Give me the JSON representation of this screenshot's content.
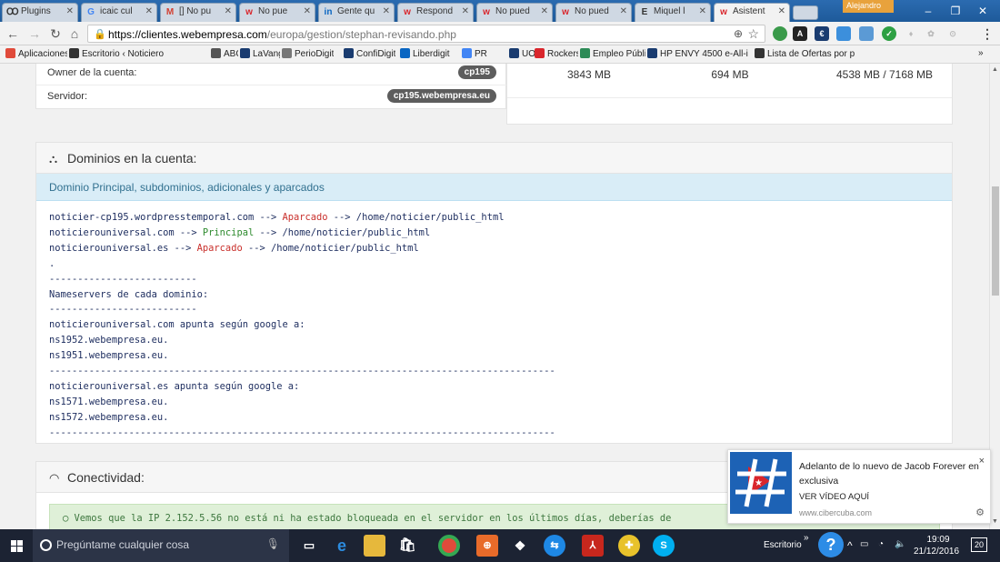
{
  "browser": {
    "tabs": [
      {
        "label": "Plugins",
        "icon": "wp-icon"
      },
      {
        "label": "icaic cul",
        "icon": "google-icon"
      },
      {
        "label": "[] No pu",
        "icon": "gmail-icon"
      },
      {
        "label": "No pue",
        "icon": "w-icon"
      },
      {
        "label": "Gente qu",
        "icon": "linkedin-icon"
      },
      {
        "label": "Respond",
        "icon": "w-icon"
      },
      {
        "label": "No pued",
        "icon": "w-icon"
      },
      {
        "label": "No pued",
        "icon": "w-icon"
      },
      {
        "label": "Miquel l",
        "icon": "e-icon"
      },
      {
        "label": "Asistent",
        "icon": "w-icon"
      }
    ],
    "profile_label": "Alejandro",
    "url": {
      "scheme": "https://",
      "host": "clientes.webempresa.com",
      "path": "/europa/gestion/stephan-revisando.php"
    },
    "bookmarks": [
      "Aplicaciones",
      "Escritorio ‹ Noticiero",
      "ABC",
      "LaVang",
      "PerioDigit",
      "ConfiDigit",
      "Liberdigit",
      "PR",
      "UOC",
      "Rockers",
      "Empleo Público orden",
      "HP ENVY 4500 e-All-i",
      "Lista de Ofertas por p"
    ],
    "bookmarks_overflow": "»"
  },
  "account": {
    "owner_label": "Owner de la cuenta:",
    "owner_value": "cp195",
    "server_label": "Servidor:",
    "server_value": "cp195.webempresa.eu"
  },
  "disk": {
    "stat1": "3843 MB",
    "stat2": "694 MB",
    "stat3": "4538 MB / 7168 MB"
  },
  "domains": {
    "title": "Dominios en la cuenta:",
    "subtitle": "Dominio Principal, subdominios, adicionales y aparcados",
    "lines": [
      {
        "pre": "noticier-cp195.wordpresstemporal.com --> ",
        "tag": "Aparcado",
        "tag_color": "red",
        "post": " --> /home/noticier/public_html"
      },
      {
        "pre": "noticierouniversal.com --> ",
        "tag": "Principal",
        "tag_color": "green",
        "post": " --> /home/noticier/public_html"
      },
      {
        "pre": "noticierouniversal.es --> ",
        "tag": "Aparcado",
        "tag_color": "red",
        "post": " --> /home/noticier/public_html"
      }
    ],
    "plain_lines": [
      ".",
      "--------------------------",
      "Nameservers de cada dominio:",
      "--------------------------",
      "noticierouniversal.com apunta según google a:",
      "ns1952.webempresa.eu.",
      "ns1951.webempresa.eu.",
      "-----------------------------------------------------------------------------------------",
      "noticierouniversal.es apunta según google a:",
      "ns1571.webempresa.eu.",
      "ns1572.webempresa.eu.",
      "-----------------------------------------------------------------------------------------"
    ]
  },
  "connectivity": {
    "title": "Conectividad:",
    "message": "Vemos que la IP 2.152.5.56 no está ni ha estado bloqueada en el servidor en los últimos días, deberías de"
  },
  "notification": {
    "title": "Adelanto de lo nuevo de Jacob Forever en exclusiva",
    "cta": "VER VÍDEO AQUÍ",
    "site": "www.cibercuba.com",
    "close": "×"
  },
  "taskbar": {
    "search_placeholder": "Pregúntame cualquier cosa",
    "desktop_label": "Escritorio",
    "time": "19:09",
    "date": "21/12/2016",
    "notifications_count": "20"
  },
  "colors": {
    "accent_info_bg": "#d9edf7",
    "success_bg": "#dff0d8",
    "tag_red": "#c9302c",
    "tag_green": "#2e8b2e",
    "taskbar": "#1c2333"
  }
}
